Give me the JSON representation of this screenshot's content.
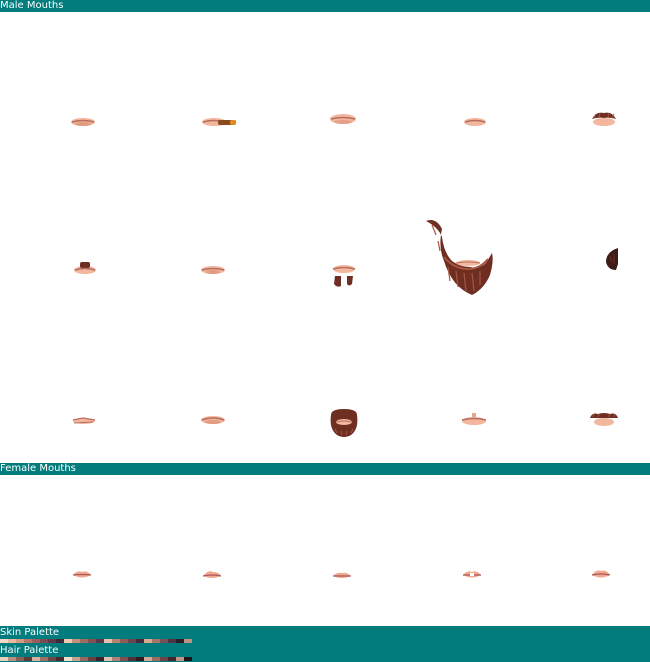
{
  "sections": {
    "male": {
      "title": "Male Mouths"
    },
    "female": {
      "title": "Female Mouths"
    }
  },
  "sprites": {
    "male": [
      "mouth-icon",
      "mouth-cigar-icon",
      "mouth-icon",
      "mouth-icon",
      "mouth-mustache-icon",
      "mouth-small-beard-icon",
      "mouth-icon",
      "mouth-goatee-icon",
      "long-beard-icon",
      "sideburn-icon",
      "mouth-icon",
      "mouth-icon",
      "full-beard-icon",
      "mouth-icon",
      "mouth-handlebar-mustache-icon"
    ],
    "female": [
      "mouth-icon",
      "mouth-icon",
      "mouth-icon",
      "mouth-icon",
      "mouth-icon"
    ]
  },
  "palettes": {
    "skin": {
      "label": "Skin Palette",
      "colors": [
        "#f4d9c8",
        "#e9b8a0",
        "#d49a82",
        "#b8756b",
        "#9a5c5c",
        "#7a4a55",
        "#5c3a4a",
        "#3d2a3a",
        "#f0c8b0",
        "#c98f7a",
        "#a06a60",
        "#804f52",
        "#5a3848",
        "#e8c0a8",
        "#b88070",
        "#8e5c58",
        "#6a4450",
        "#402c3c",
        "#d8a890",
        "#a87468",
        "#78505a",
        "#4c3444",
        "#2a1c28",
        "#c09080"
      ]
    },
    "hair": {
      "label": "Hair Palette",
      "colors": [
        "#e6d0c0",
        "#b89080",
        "#8a6058",
        "#5c3c3c",
        "#d8b0a0",
        "#a07068",
        "#704848",
        "#482c30",
        "#f0e0d0",
        "#c8a090",
        "#986860",
        "#684040",
        "#3c2428",
        "#e0c0b0",
        "#b08078",
        "#805050",
        "#503038",
        "#2c1c20",
        "#d0a898",
        "#9c6c64",
        "#6c4444",
        "#40282c",
        "#c4968a",
        "#201418"
      ]
    }
  }
}
